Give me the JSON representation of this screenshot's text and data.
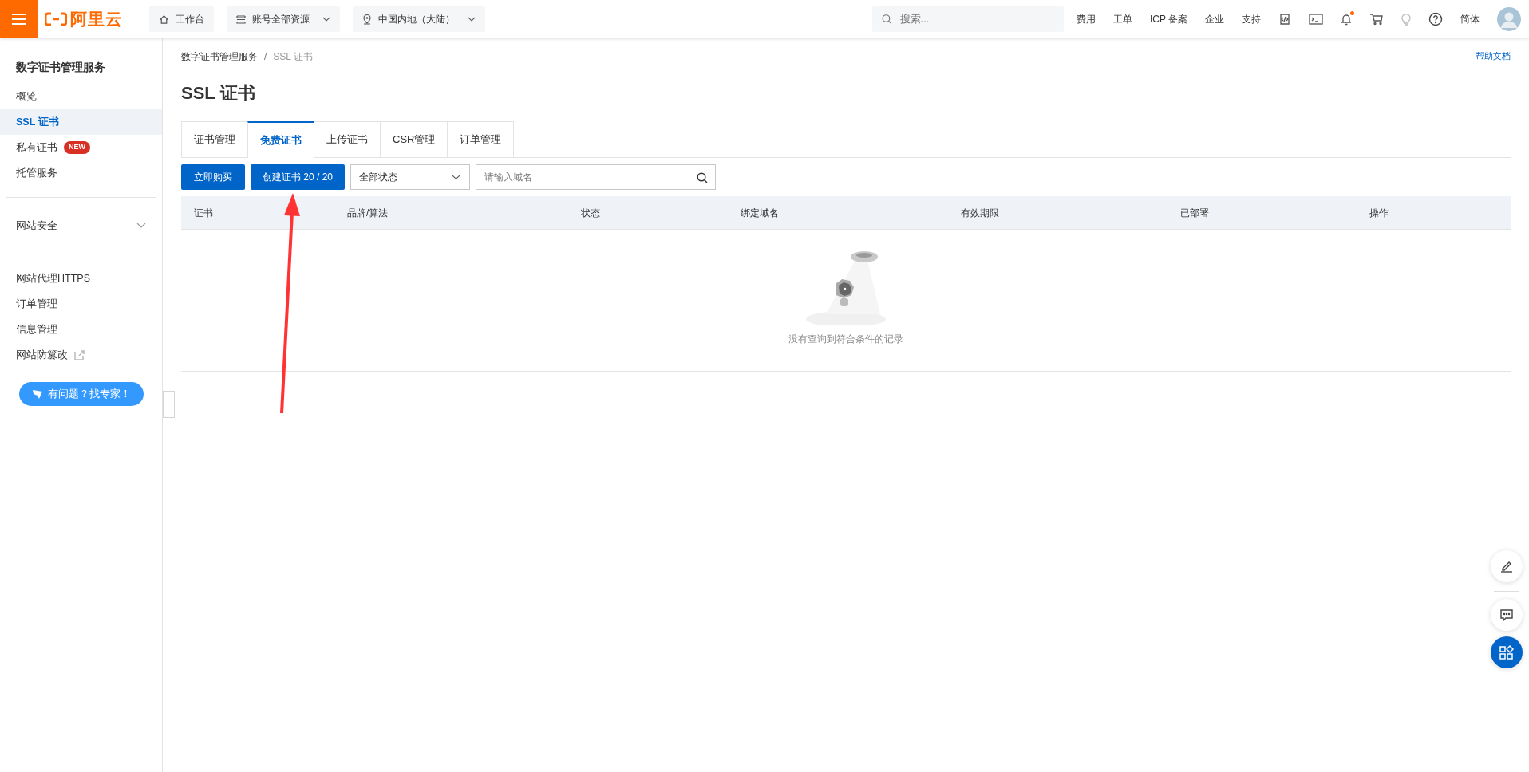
{
  "topbar": {
    "logo_text": "阿里云",
    "nav_buttons": [
      {
        "label": "工作台",
        "kind": "home",
        "dropdown": false
      },
      {
        "label": "账号全部资源",
        "kind": "resources",
        "dropdown": true
      },
      {
        "label": "中国内地（大陆）",
        "kind": "location",
        "dropdown": true
      }
    ],
    "search": {
      "placeholder": "搜索..."
    },
    "links": [
      "费用",
      "工单",
      "ICP 备案",
      "企业",
      "支持"
    ],
    "notification_unread": true,
    "language": "简体"
  },
  "sidebar": {
    "title": "数字证书管理服务",
    "sections": [
      {
        "items": [
          {
            "label": "概览",
            "selected": false,
            "external": false
          },
          {
            "label": "SSL 证书",
            "selected": true,
            "external": false
          },
          {
            "label": "私有证书",
            "selected": false,
            "external": false,
            "badge": "NEW"
          },
          {
            "label": "托管服务",
            "selected": false,
            "external": false
          }
        ]
      },
      {
        "group": {
          "label": "网站安全",
          "expanded": false
        }
      },
      {
        "items": [
          {
            "label": "网站代理HTTPS",
            "selected": false,
            "external": false
          },
          {
            "label": "订单管理",
            "selected": false,
            "external": false
          },
          {
            "label": "信息管理",
            "selected": false,
            "external": false
          },
          {
            "label": "网站防篡改",
            "selected": false,
            "external": true
          }
        ]
      }
    ],
    "help_button": "有问题？找专家！"
  },
  "main": {
    "breadcrumb": [
      "数字证书管理服务",
      "SSL 证书"
    ],
    "breadcrumb_separator": "/",
    "help_link": "帮助文档",
    "title": "SSL 证书",
    "tabs": [
      {
        "label": "证书管理",
        "selected": false
      },
      {
        "label": "免费证书",
        "selected": true
      },
      {
        "label": "上传证书",
        "selected": false
      },
      {
        "label": "CSR管理",
        "selected": false
      },
      {
        "label": "订单管理",
        "selected": false
      }
    ],
    "toolbar": {
      "buy_button": "立即购买",
      "create_button": "创建证书 20 / 20",
      "status_select": "全部状态",
      "domain_search": {
        "placeholder": "请输入域名"
      }
    },
    "table": {
      "columns": [
        "证书",
        "品牌/算法",
        "状态",
        "绑定域名",
        "有效期限",
        "已部署",
        "操作"
      ],
      "empty_text": "没有查询到符合条件的记录"
    }
  }
}
